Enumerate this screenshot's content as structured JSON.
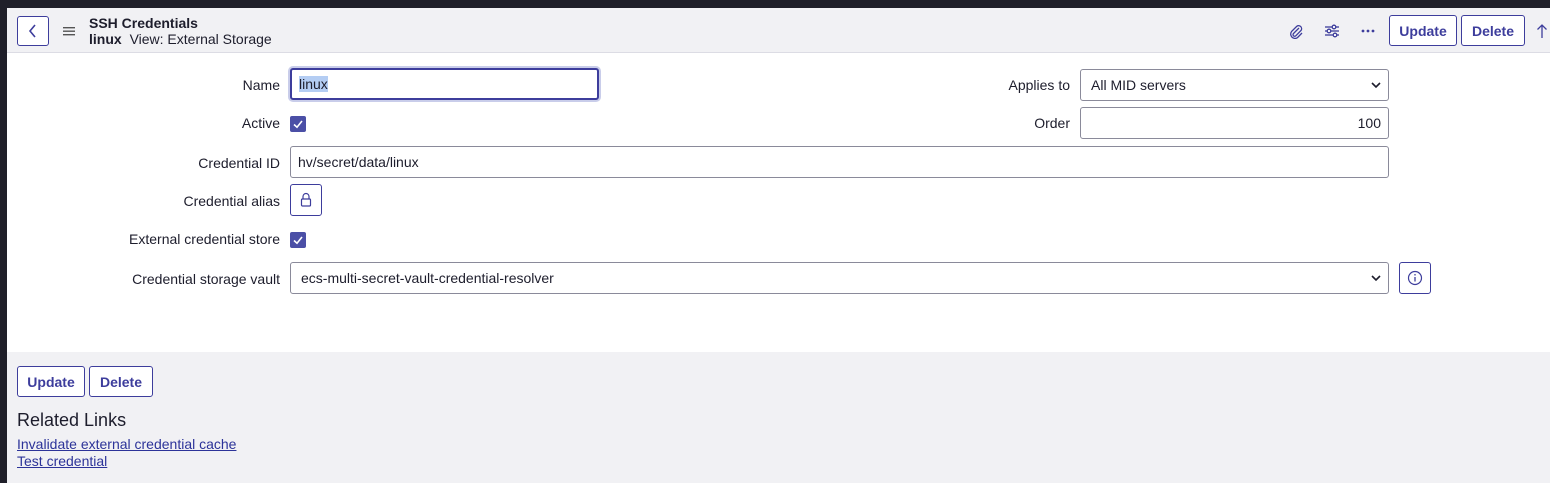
{
  "header": {
    "table_name": "SSH Credentials",
    "record_name": "linux",
    "view_label": "View: External Storage",
    "icons": [
      "back-icon",
      "hamburger-menu-icon",
      "paperclip-icon",
      "sliders-icon",
      "ellipsis-icon",
      "arrow-up-icon"
    ],
    "update_label": "Update",
    "delete_label": "Delete"
  },
  "form": {
    "name_label": "Name",
    "name_value": "linux",
    "applies_to_label": "Applies to",
    "applies_to_value": "All MID servers",
    "active_label": "Active",
    "active_checked": true,
    "order_label": "Order",
    "order_value": "100",
    "credential_id_label": "Credential ID",
    "credential_id_value": "hv/secret/data/linux",
    "credential_alias_label": "Credential alias",
    "credential_alias_icon": "lock-icon",
    "external_store_label": "External credential store",
    "external_store_checked": true,
    "storage_vault_label": "Credential storage vault",
    "storage_vault_value": "ecs-multi-secret-vault-credential-resolver",
    "storage_vault_info_icon": "info-icon"
  },
  "footer": {
    "update_label": "Update",
    "delete_label": "Delete",
    "related_links_title": "Related Links",
    "links": [
      "Invalidate external credential cache",
      "Test credential"
    ]
  },
  "colors": {
    "accent": "#3d3d9c",
    "checkbox": "#4b4fa6",
    "header_bg": "#f1f1f4",
    "link": "#2c3399"
  }
}
